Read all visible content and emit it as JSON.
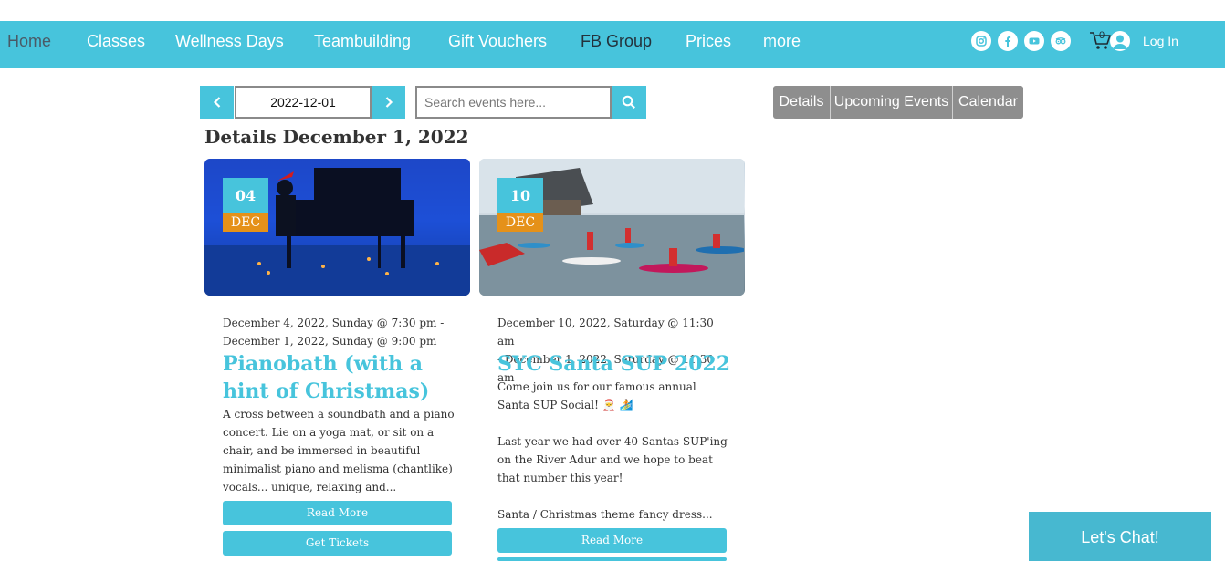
{
  "nav": {
    "items": [
      "Home",
      "Classes",
      "Wellness Days",
      "Teambuilding",
      "Gift Vouchers",
      "FB Group",
      "Prices",
      "more"
    ],
    "cart_count": "0",
    "login_label": "Log In"
  },
  "social_icons": [
    "instagram-icon",
    "facebook-icon",
    "youtube-icon",
    "tripadvisor-icon"
  ],
  "date_nav": {
    "current_date": "2022-12-01",
    "search_placeholder": "Search events here..."
  },
  "view_tabs": [
    "Details",
    "Upcoming Events",
    "Calendar"
  ],
  "page_heading": "Details December 1, 2022",
  "events": [
    {
      "day": "04",
      "month": "DEC",
      "date_line_1": "December 4, 2022, Sunday @ 7:30 pm -",
      "date_line_2": "December 1, 2022, Sunday @ 9:00 pm",
      "title": "Pianobath (with a hint of Christmas)",
      "desc": [
        "A cross between a soundbath and a piano concert. Lie on a yoga mat, or sit on a chair, and be immersed in beautiful minimalist piano and melisma (chantlike) vocals... unique, relaxing and..."
      ],
      "read_more": "Read More",
      "tickets": "Get Tickets"
    },
    {
      "day": "10",
      "month": "DEC",
      "date_line_1": "December 10, 2022, Saturday @ 11:30 am",
      "date_line_2": "- December 1, 2022, Saturday @ 11:30 am",
      "title": "SYC Santa SUP 2022",
      "desc": [
        "Come join us for our famous annual Santa SUP Social! 🎅 🏄",
        "Last year we had over 40 Santas SUP'ing on the River Adur and we hope to beat that number this year!",
        "Santa / Christmas theme fancy dress..."
      ],
      "read_more": "Read More"
    }
  ],
  "chat_label": "Let's Chat!",
  "colors": {
    "accent": "#47c4dc",
    "badge_month": "#e59119",
    "tab_gray": "#8e8e8e"
  }
}
